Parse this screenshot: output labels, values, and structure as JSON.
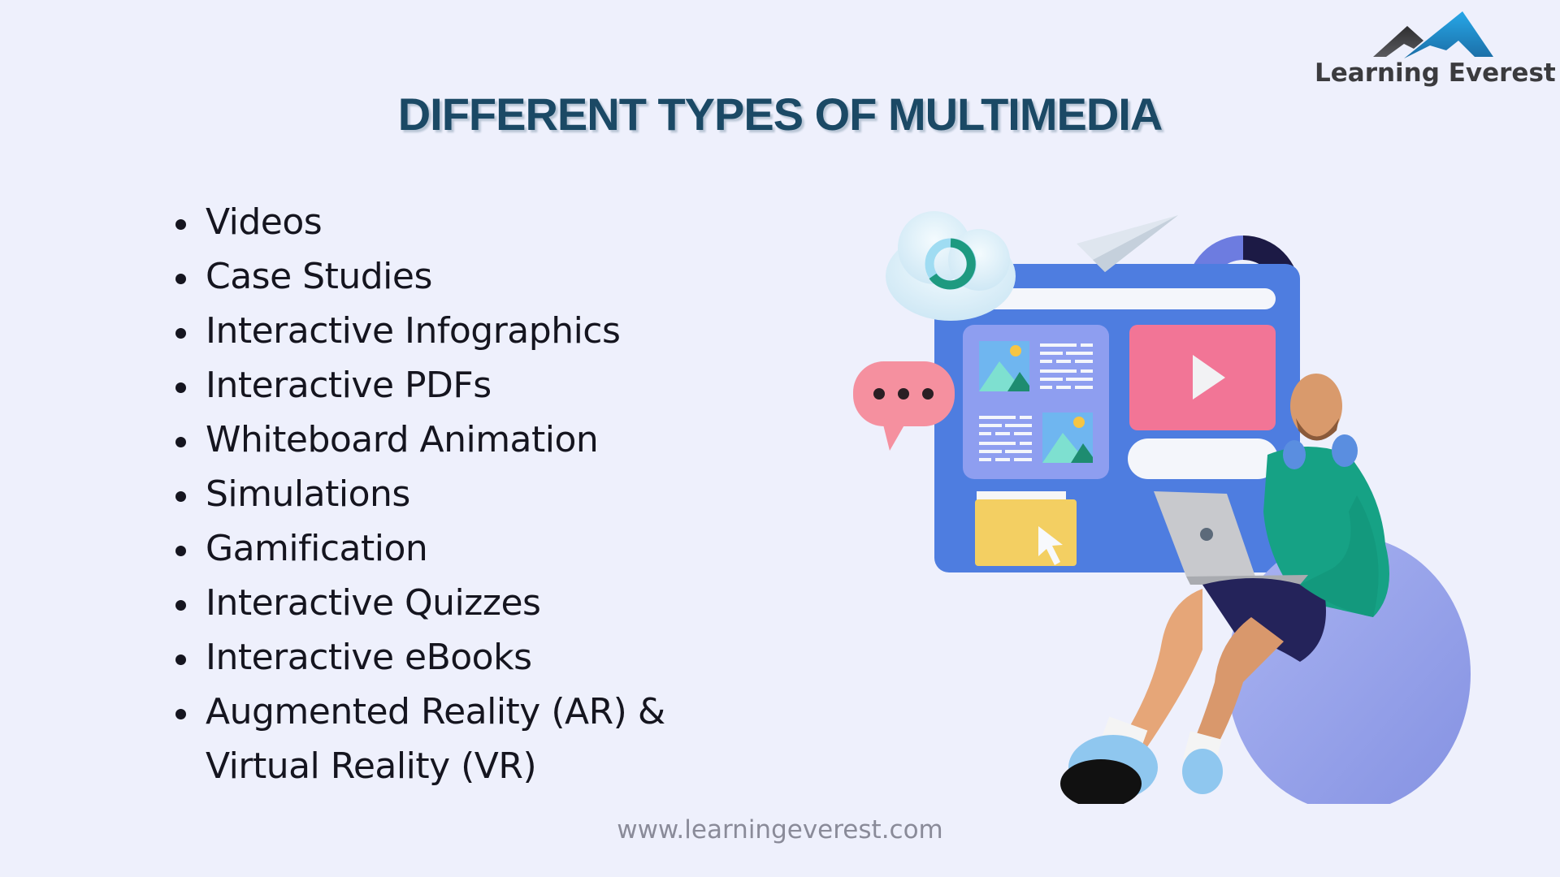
{
  "brand": {
    "logo_text": "Learning Everest",
    "logo_icon": "mountain-icon",
    "colors": {
      "mountain_dark": "#3b3b3e",
      "mountain_blue": "#1f8fd1"
    }
  },
  "header": {
    "title": "DIFFERENT TYPES OF MULTIMEDIA",
    "title_color": "#1b4965"
  },
  "list": {
    "items": [
      {
        "label": "Videos"
      },
      {
        "label": "Case Studies"
      },
      {
        "label": "Interactive Infographics"
      },
      {
        "label": "Interactive PDFs"
      },
      {
        "label": "Whiteboard Animation"
      },
      {
        "label": "Simulations"
      },
      {
        "label": "Gamification"
      },
      {
        "label": "Interactive Quizzes"
      },
      {
        "label": "Interactive eBooks"
      },
      {
        "label": "Augmented Reality (AR) &",
        "continuation": "Virtual Reality (VR)"
      }
    ]
  },
  "illustration": {
    "elements": [
      "cloud-donut-icon",
      "paper-plane-icon",
      "donut-chart-icon",
      "browser-window",
      "image-icon",
      "text-lines-icon",
      "video-play-icon",
      "chat-bubble-icon",
      "folder-icon",
      "cursor-icon",
      "person-with-laptop",
      "beanbag"
    ],
    "colors": {
      "window_blue": "#4e7de0",
      "panel_lavender": "#8e9ef0",
      "video_pink": "#f27596",
      "bubble_pink": "#f5909f",
      "teal": "#1e9a80",
      "navy": "#1c1a45",
      "periwinkle": "#6d7ce0",
      "folder_yellow": "#f3cf62",
      "beanbag": "#98a4ec",
      "hoodie": "#16a285"
    }
  },
  "footer": {
    "url": "www.learningeverest.com"
  }
}
